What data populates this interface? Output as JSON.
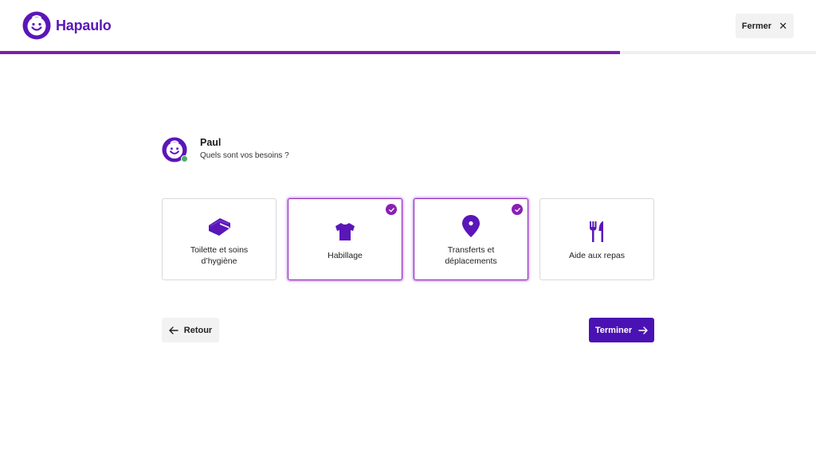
{
  "brand": {
    "name": "Hapaulo",
    "primary_color": "#5b16b8",
    "accent_color": "#8a1fb5",
    "button_color": "#4a12b3"
  },
  "header": {
    "close_label": "Fermer",
    "close_icon": "close-icon"
  },
  "progress": {
    "value_percent": 76
  },
  "question": {
    "name": "Paul",
    "text": "Quels sont vos besoins ?",
    "status": "online"
  },
  "options": [
    {
      "label": "Toilette et soins d’hygiène",
      "icon": "towel-icon",
      "selected": false
    },
    {
      "label": "Habillage",
      "icon": "tshirt-icon",
      "selected": true
    },
    {
      "label": "Transferts et déplacements",
      "icon": "location-pin-icon",
      "selected": true
    },
    {
      "label": "Aide aux repas",
      "icon": "fork-knife-icon",
      "selected": false
    }
  ],
  "footer": {
    "back_label": "Retour",
    "finish_label": "Terminer"
  }
}
